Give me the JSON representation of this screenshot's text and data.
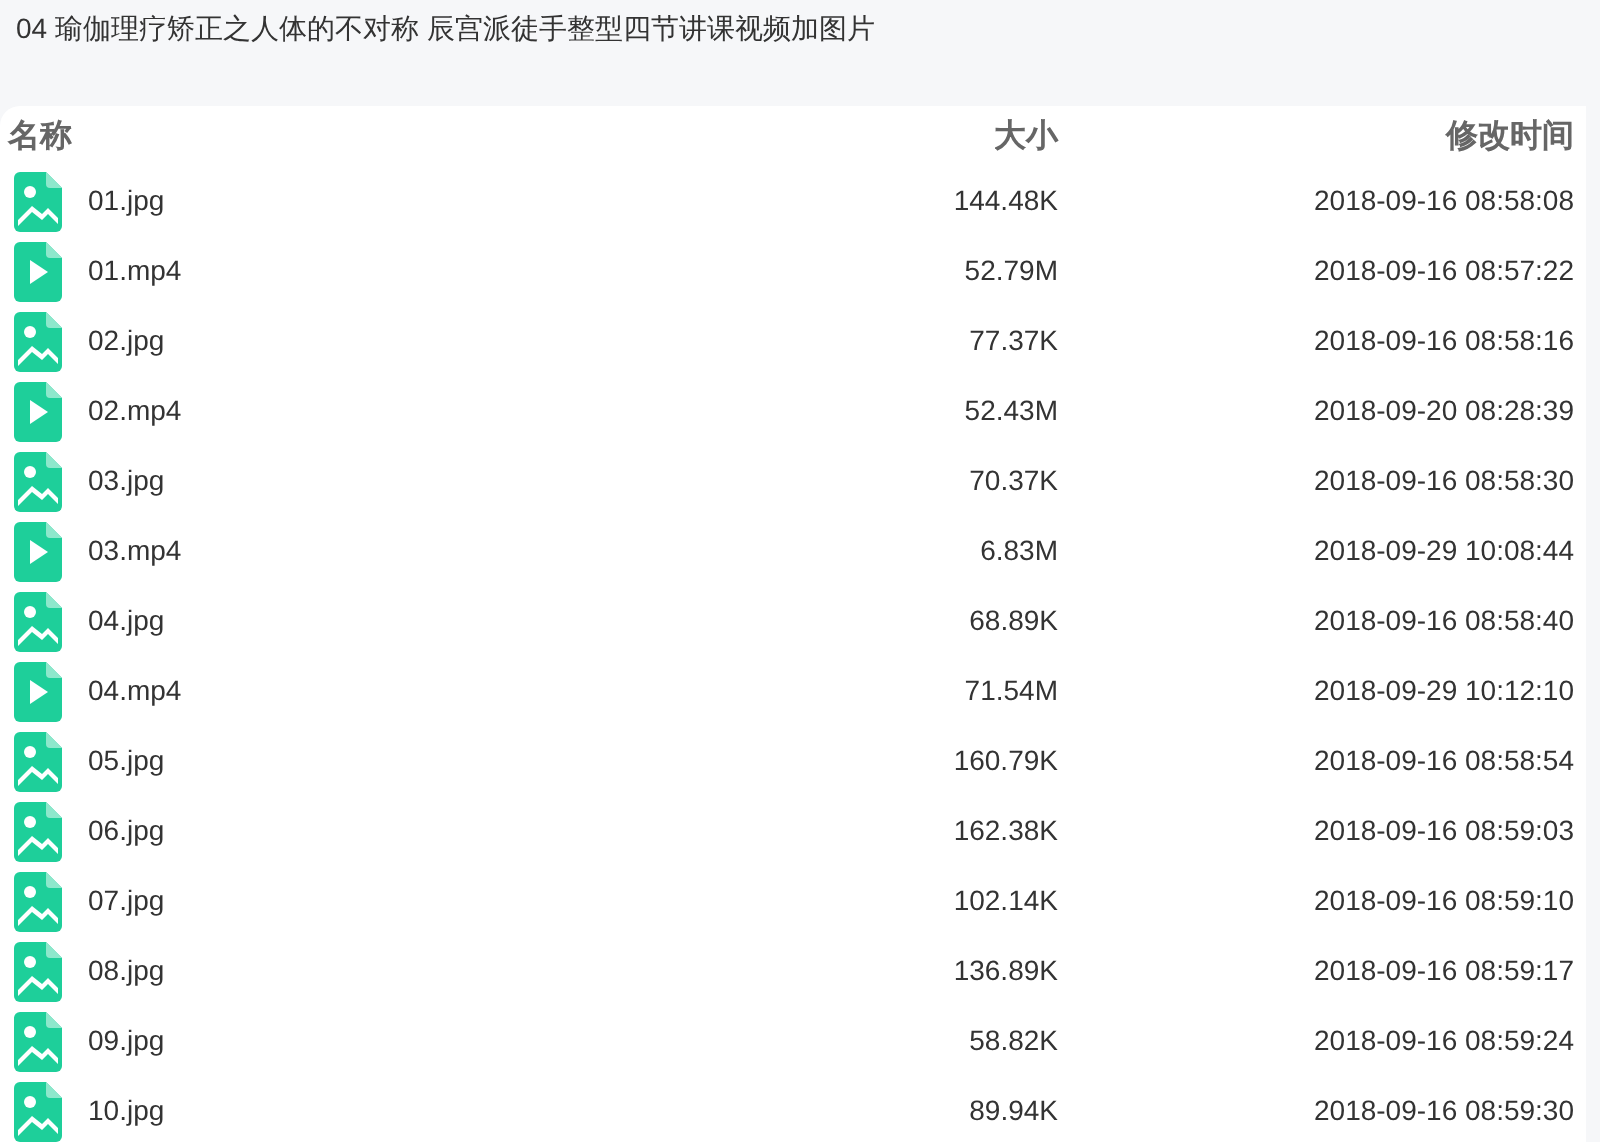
{
  "title": "04 瑜伽理疗矫正之人体的不对称 辰宫派徒手整型四节讲课视频加图片",
  "columns": [
    "名称",
    "大小",
    "修改时间"
  ],
  "files": [
    {
      "kind": "image",
      "name": "01.jpg",
      "size": "144.48K",
      "modified": "2018-09-16 08:58:08"
    },
    {
      "kind": "video",
      "name": "01.mp4",
      "size": "52.79M",
      "modified": "2018-09-16 08:57:22"
    },
    {
      "kind": "image",
      "name": "02.jpg",
      "size": "77.37K",
      "modified": "2018-09-16 08:58:16"
    },
    {
      "kind": "video",
      "name": "02.mp4",
      "size": "52.43M",
      "modified": "2018-09-20 08:28:39"
    },
    {
      "kind": "image",
      "name": "03.jpg",
      "size": "70.37K",
      "modified": "2018-09-16 08:58:30"
    },
    {
      "kind": "video",
      "name": "03.mp4",
      "size": "6.83M",
      "modified": "2018-09-29 10:08:44"
    },
    {
      "kind": "image",
      "name": "04.jpg",
      "size": "68.89K",
      "modified": "2018-09-16 08:58:40"
    },
    {
      "kind": "video",
      "name": "04.mp4",
      "size": "71.54M",
      "modified": "2018-09-29 10:12:10"
    },
    {
      "kind": "image",
      "name": "05.jpg",
      "size": "160.79K",
      "modified": "2018-09-16 08:58:54"
    },
    {
      "kind": "image",
      "name": "06.jpg",
      "size": "162.38K",
      "modified": "2018-09-16 08:59:03"
    },
    {
      "kind": "image",
      "name": "07.jpg",
      "size": "102.14K",
      "modified": "2018-09-16 08:59:10"
    },
    {
      "kind": "image",
      "name": "08.jpg",
      "size": "136.89K",
      "modified": "2018-09-16 08:59:17"
    },
    {
      "kind": "image",
      "name": "09.jpg",
      "size": "58.82K",
      "modified": "2018-09-16 08:59:24"
    },
    {
      "kind": "image",
      "name": "10.jpg",
      "size": "89.94K",
      "modified": "2018-09-16 08:59:30"
    }
  ]
}
